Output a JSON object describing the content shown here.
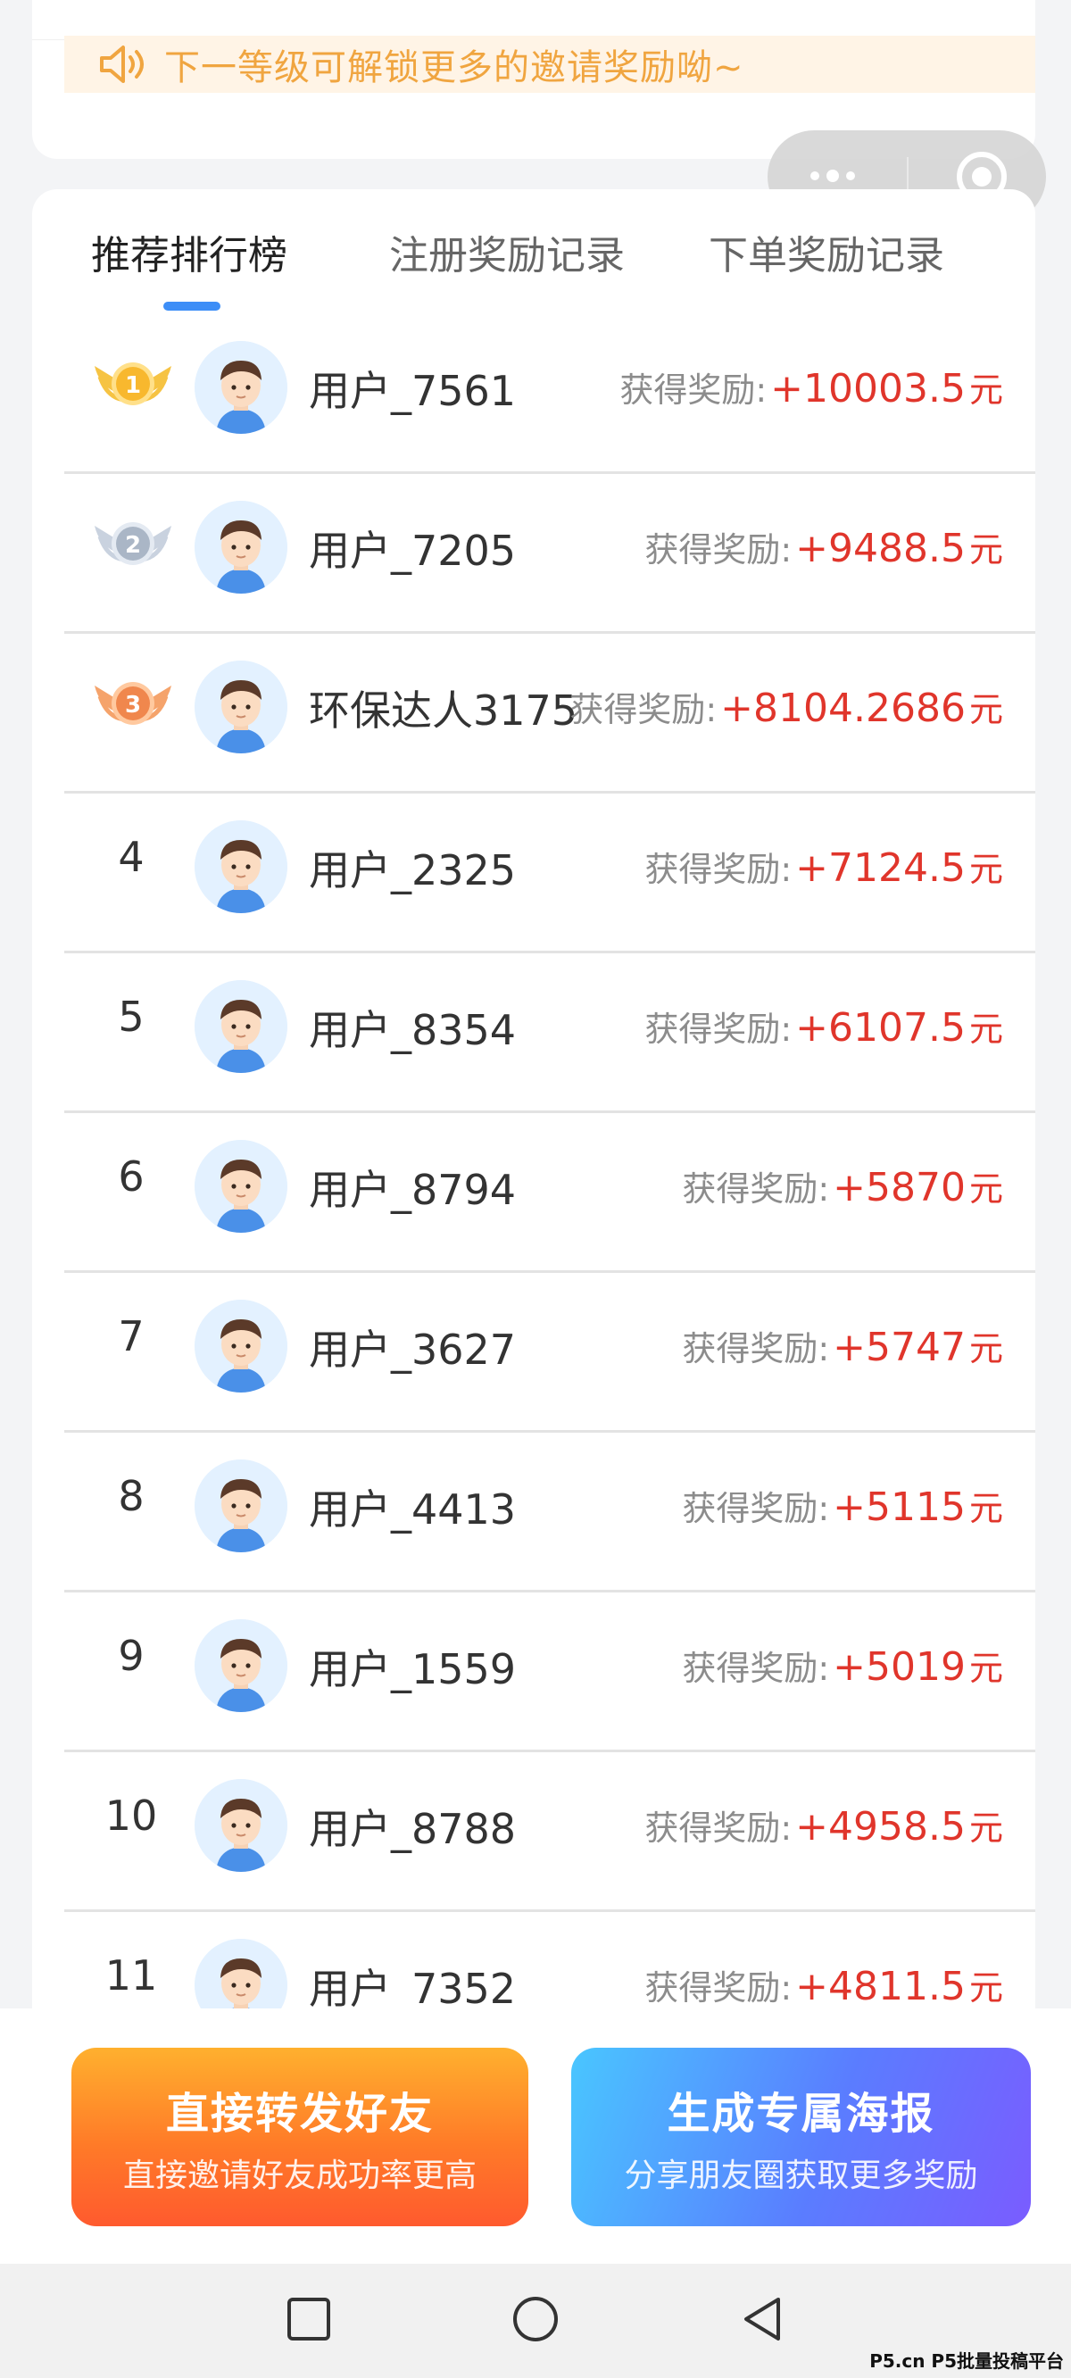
{
  "notice": {
    "text": "下一等级可解锁更多的邀请奖励呦~"
  },
  "tabs": [
    {
      "label": "推荐排行榜",
      "active": true
    },
    {
      "label": "注册奖励记录",
      "active": false
    },
    {
      "label": "下单奖励记录",
      "active": false
    }
  ],
  "reward_label": "获得奖励:",
  "currency_unit": "元",
  "ranking": [
    {
      "rank": "1",
      "medal": "gold-medal",
      "name": "用户_7561",
      "amount": "+10003.5"
    },
    {
      "rank": "2",
      "medal": "silver-medal",
      "name": "用户_7205",
      "amount": "+9488.5"
    },
    {
      "rank": "3",
      "medal": "bronze-medal",
      "name": "环保达人3175",
      "amount": "+8104.2686"
    },
    {
      "rank": "4",
      "name": "用户_2325",
      "amount": "+7124.5"
    },
    {
      "rank": "5",
      "name": "用户_8354",
      "amount": "+6107.5"
    },
    {
      "rank": "6",
      "name": "用户_8794",
      "amount": "+5870"
    },
    {
      "rank": "7",
      "name": "用户_3627",
      "amount": "+5747"
    },
    {
      "rank": "8",
      "name": "用户_4413",
      "amount": "+5115"
    },
    {
      "rank": "9",
      "name": "用户_1559",
      "amount": "+5019"
    },
    {
      "rank": "10",
      "name": "用户_8788",
      "amount": "+4958.5"
    },
    {
      "rank": "11",
      "name": "用户_7352",
      "amount": "+4811.5"
    }
  ],
  "buttons": {
    "forward": {
      "title": "直接转发好友",
      "subtitle": "直接邀请好友成功率更高"
    },
    "poster": {
      "title": "生成专属海报",
      "subtitle": "分享朋友圈获取更多奖励"
    }
  },
  "colors": {
    "accent_blue": "#3d8ef7",
    "reward_red": "#e0352b",
    "notice_orange": "#f0a540"
  },
  "watermark": "P5.cn P5批量投稿平台"
}
